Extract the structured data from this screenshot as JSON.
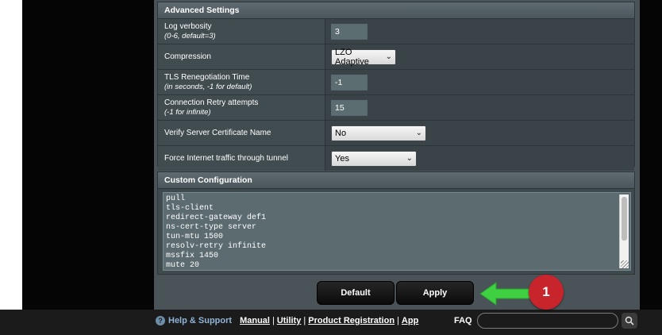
{
  "advanced": {
    "title": "Advanced Settings",
    "log_verbosity": {
      "label": "Log verbosity",
      "sub": "(0-6, default=3)",
      "value": "3"
    },
    "compression": {
      "label": "Compression",
      "value": "LZO Adaptive"
    },
    "tls": {
      "label": "TLS Renegotiation Time",
      "sub": "(in seconds, -1 for default)",
      "value": "-1"
    },
    "retry": {
      "label": "Connection Retry attempts",
      "sub": "(-1 for infinite)",
      "value": "15"
    },
    "verify": {
      "label": "Verify Server Certificate Name",
      "value": "No"
    },
    "force": {
      "label": "Force Internet traffic through tunnel",
      "value": "Yes"
    }
  },
  "custom": {
    "title": "Custom Configuration",
    "lines": [
      "pull",
      "tls-client",
      "redirect-gateway def1",
      "ns-cert-type server",
      "tun-mtu 1500",
      "resolv-retry infinite",
      "mssfix 1450",
      "mute 20"
    ]
  },
  "buttons": {
    "default_label": "Default",
    "apply_label": "Apply"
  },
  "callout": {
    "number": "1",
    "color": "#c8242b",
    "arrow_color": "#3fd042"
  },
  "footer": {
    "help_label": "Help & Support",
    "links": [
      "Manual",
      "Utility",
      "Product Registration",
      "App"
    ],
    "separator": "|",
    "faq_label": "FAQ"
  }
}
